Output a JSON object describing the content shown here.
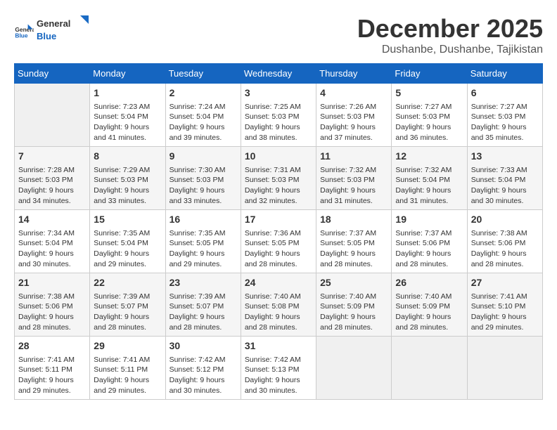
{
  "logo": {
    "general": "General",
    "blue": "Blue"
  },
  "header": {
    "month": "December 2025",
    "location": "Dushanbe, Dushanbe, Tajikistan"
  },
  "days": [
    "Sunday",
    "Monday",
    "Tuesday",
    "Wednesday",
    "Thursday",
    "Friday",
    "Saturday"
  ],
  "weeks": [
    [
      {
        "day": "",
        "info": ""
      },
      {
        "day": "1",
        "info": "Sunrise: 7:23 AM\nSunset: 5:04 PM\nDaylight: 9 hours\nand 41 minutes."
      },
      {
        "day": "2",
        "info": "Sunrise: 7:24 AM\nSunset: 5:04 PM\nDaylight: 9 hours\nand 39 minutes."
      },
      {
        "day": "3",
        "info": "Sunrise: 7:25 AM\nSunset: 5:03 PM\nDaylight: 9 hours\nand 38 minutes."
      },
      {
        "day": "4",
        "info": "Sunrise: 7:26 AM\nSunset: 5:03 PM\nDaylight: 9 hours\nand 37 minutes."
      },
      {
        "day": "5",
        "info": "Sunrise: 7:27 AM\nSunset: 5:03 PM\nDaylight: 9 hours\nand 36 minutes."
      },
      {
        "day": "6",
        "info": "Sunrise: 7:27 AM\nSunset: 5:03 PM\nDaylight: 9 hours\nand 35 minutes."
      }
    ],
    [
      {
        "day": "7",
        "info": "Sunrise: 7:28 AM\nSunset: 5:03 PM\nDaylight: 9 hours\nand 34 minutes."
      },
      {
        "day": "8",
        "info": "Sunrise: 7:29 AM\nSunset: 5:03 PM\nDaylight: 9 hours\nand 33 minutes."
      },
      {
        "day": "9",
        "info": "Sunrise: 7:30 AM\nSunset: 5:03 PM\nDaylight: 9 hours\nand 33 minutes."
      },
      {
        "day": "10",
        "info": "Sunrise: 7:31 AM\nSunset: 5:03 PM\nDaylight: 9 hours\nand 32 minutes."
      },
      {
        "day": "11",
        "info": "Sunrise: 7:32 AM\nSunset: 5:03 PM\nDaylight: 9 hours\nand 31 minutes."
      },
      {
        "day": "12",
        "info": "Sunrise: 7:32 AM\nSunset: 5:04 PM\nDaylight: 9 hours\nand 31 minutes."
      },
      {
        "day": "13",
        "info": "Sunrise: 7:33 AM\nSunset: 5:04 PM\nDaylight: 9 hours\nand 30 minutes."
      }
    ],
    [
      {
        "day": "14",
        "info": "Sunrise: 7:34 AM\nSunset: 5:04 PM\nDaylight: 9 hours\nand 30 minutes."
      },
      {
        "day": "15",
        "info": "Sunrise: 7:35 AM\nSunset: 5:04 PM\nDaylight: 9 hours\nand 29 minutes."
      },
      {
        "day": "16",
        "info": "Sunrise: 7:35 AM\nSunset: 5:05 PM\nDaylight: 9 hours\nand 29 minutes."
      },
      {
        "day": "17",
        "info": "Sunrise: 7:36 AM\nSunset: 5:05 PM\nDaylight: 9 hours\nand 28 minutes."
      },
      {
        "day": "18",
        "info": "Sunrise: 7:37 AM\nSunset: 5:05 PM\nDaylight: 9 hours\nand 28 minutes."
      },
      {
        "day": "19",
        "info": "Sunrise: 7:37 AM\nSunset: 5:06 PM\nDaylight: 9 hours\nand 28 minutes."
      },
      {
        "day": "20",
        "info": "Sunrise: 7:38 AM\nSunset: 5:06 PM\nDaylight: 9 hours\nand 28 minutes."
      }
    ],
    [
      {
        "day": "21",
        "info": "Sunrise: 7:38 AM\nSunset: 5:06 PM\nDaylight: 9 hours\nand 28 minutes."
      },
      {
        "day": "22",
        "info": "Sunrise: 7:39 AM\nSunset: 5:07 PM\nDaylight: 9 hours\nand 28 minutes."
      },
      {
        "day": "23",
        "info": "Sunrise: 7:39 AM\nSunset: 5:07 PM\nDaylight: 9 hours\nand 28 minutes."
      },
      {
        "day": "24",
        "info": "Sunrise: 7:40 AM\nSunset: 5:08 PM\nDaylight: 9 hours\nand 28 minutes."
      },
      {
        "day": "25",
        "info": "Sunrise: 7:40 AM\nSunset: 5:09 PM\nDaylight: 9 hours\nand 28 minutes."
      },
      {
        "day": "26",
        "info": "Sunrise: 7:40 AM\nSunset: 5:09 PM\nDaylight: 9 hours\nand 28 minutes."
      },
      {
        "day": "27",
        "info": "Sunrise: 7:41 AM\nSunset: 5:10 PM\nDaylight: 9 hours\nand 29 minutes."
      }
    ],
    [
      {
        "day": "28",
        "info": "Sunrise: 7:41 AM\nSunset: 5:11 PM\nDaylight: 9 hours\nand 29 minutes."
      },
      {
        "day": "29",
        "info": "Sunrise: 7:41 AM\nSunset: 5:11 PM\nDaylight: 9 hours\nand 29 minutes."
      },
      {
        "day": "30",
        "info": "Sunrise: 7:42 AM\nSunset: 5:12 PM\nDaylight: 9 hours\nand 30 minutes."
      },
      {
        "day": "31",
        "info": "Sunrise: 7:42 AM\nSunset: 5:13 PM\nDaylight: 9 hours\nand 30 minutes."
      },
      {
        "day": "",
        "info": ""
      },
      {
        "day": "",
        "info": ""
      },
      {
        "day": "",
        "info": ""
      }
    ]
  ]
}
